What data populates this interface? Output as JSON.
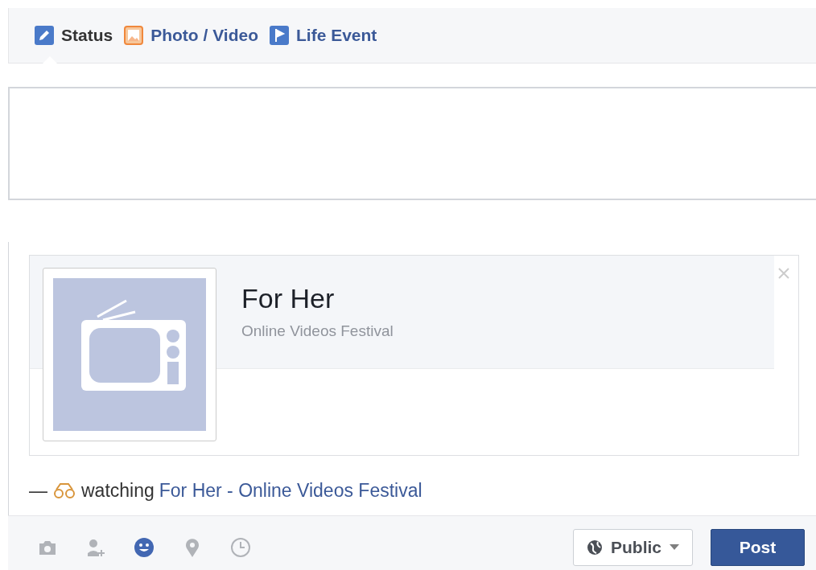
{
  "tabs": [
    {
      "kind": "status",
      "label": "Status",
      "selected": true
    },
    {
      "kind": "photo",
      "label": "Photo / Video",
      "selected": false
    },
    {
      "kind": "event",
      "label": "Life Event",
      "selected": false
    }
  ],
  "attachment": {
    "title": "For Her",
    "subtitle": "Online Videos Festival"
  },
  "activity": {
    "dash": "—",
    "verb": "watching",
    "link": "For Her - Online Videos Festival"
  },
  "tools": [
    {
      "kind": "camera",
      "active": false
    },
    {
      "kind": "tag",
      "active": false
    },
    {
      "kind": "feeling",
      "active": true
    },
    {
      "kind": "location",
      "active": false
    },
    {
      "kind": "time",
      "active": false
    }
  ],
  "privacy": {
    "label": "Public"
  },
  "post_button": "Post"
}
